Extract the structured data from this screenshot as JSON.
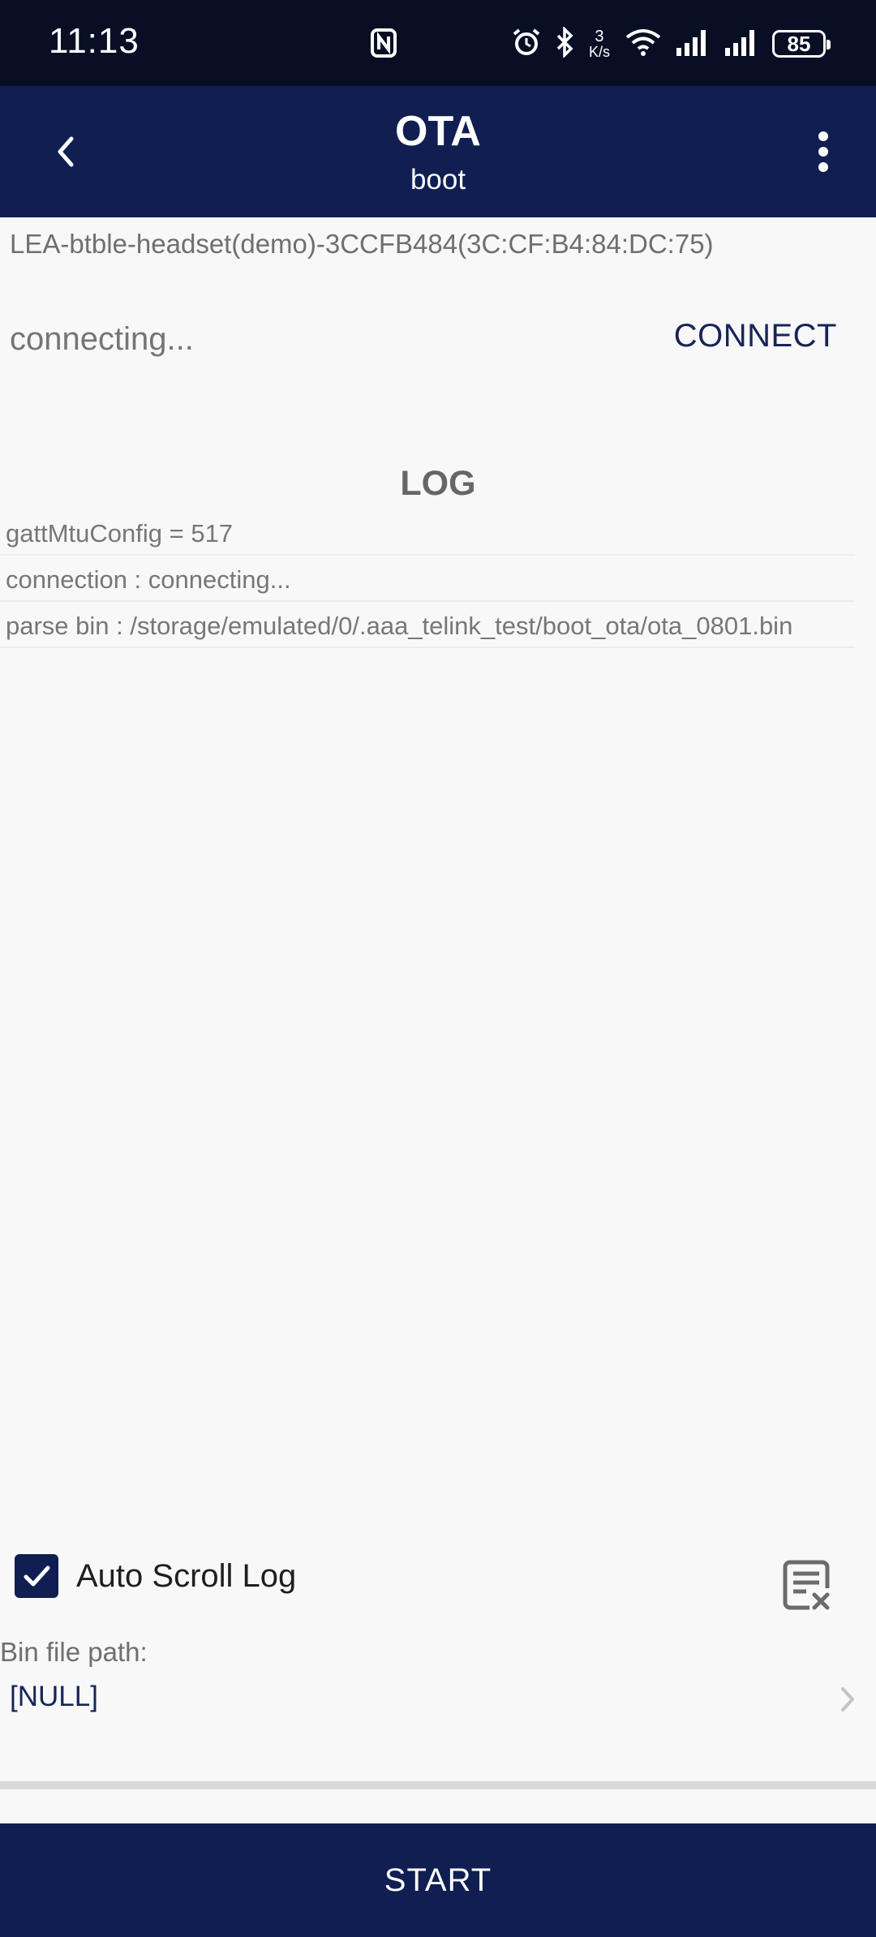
{
  "status_bar": {
    "time": "11:13",
    "net_speed_value": "3",
    "net_speed_unit": "K/s",
    "battery_level": "85",
    "icons": [
      "nfc-icon",
      "alarm-icon",
      "bluetooth-icon",
      "wifi-icon",
      "signal-icon",
      "signal-icon",
      "battery-icon"
    ]
  },
  "app_bar": {
    "title": "OTA",
    "subtitle": "boot",
    "back_icon": "back-chevron-icon",
    "menu_icon": "more-vert-icon",
    "background": "#101e52"
  },
  "device": {
    "name": "LEA-btble-headset(demo)-3CCFB484(3C:CF:B4:84:DC:75)",
    "connection_state": "connecting...",
    "connect_label": "CONNECT"
  },
  "log": {
    "heading": "LOG",
    "entries": [
      "gattMtuConfig = 517",
      "connection : connecting...",
      "parse bin : /storage/emulated/0/.aaa_telink_test/boot_ota/ota_0801.bin"
    ]
  },
  "options": {
    "auto_scroll_label": "Auto Scroll Log",
    "auto_scroll_checked": true,
    "clear_log_icon": "clear-log-icon"
  },
  "bin_file": {
    "label": "Bin file path:",
    "value": "[NULL]"
  },
  "actions": {
    "start_label": "START"
  }
}
